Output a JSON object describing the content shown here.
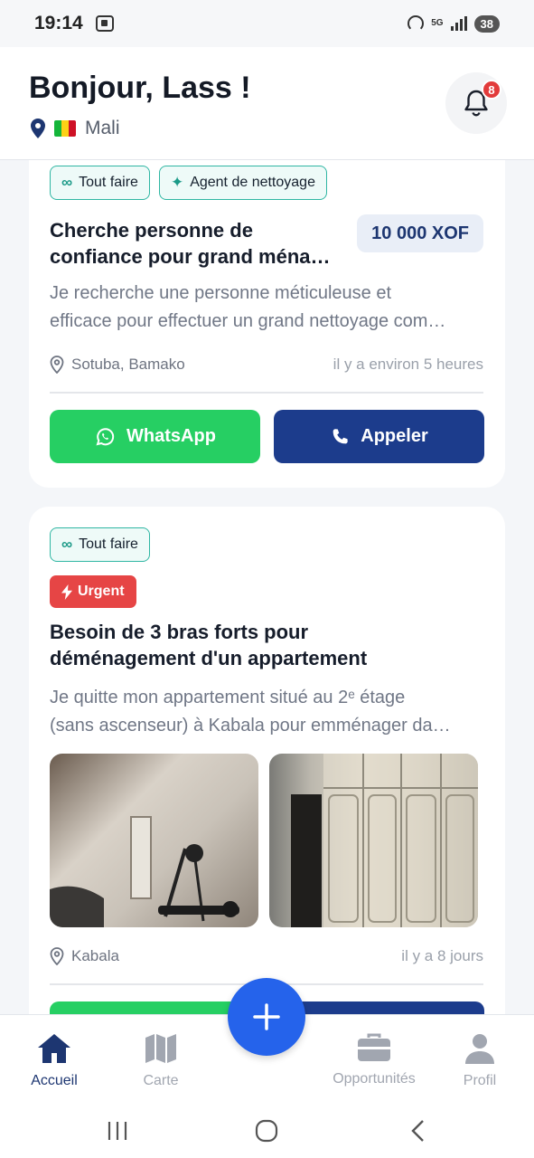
{
  "status_bar": {
    "time": "19:14",
    "network": "5G",
    "battery": "38"
  },
  "header": {
    "greeting": "Bonjour, Lass !",
    "country": "Mali",
    "notification_count": "8"
  },
  "posts": [
    {
      "tags": [
        {
          "label": "Tout faire",
          "icon": "infinity-icon"
        },
        {
          "label": "Agent de nettoyage",
          "icon": "sparkles-icon"
        }
      ],
      "title_line1": "Cherche personne de",
      "title_line2": "confiance pour grand ména…",
      "price": "10 000 XOF",
      "desc_line1": "Je recherche une personne méticuleuse et",
      "desc_line2": "efficace pour effectuer un grand nettoyage com…",
      "location": "Sotuba, Bamako",
      "posted": "il y a environ 5 heures",
      "whatsapp_label": "WhatsApp",
      "call_label": "Appeler"
    },
    {
      "tags": [
        {
          "label": "Tout faire",
          "icon": "infinity-icon"
        }
      ],
      "urgent_label": "Urgent",
      "title_line1": "Besoin de 3 bras forts pour",
      "title_line2": "déménagement d'un appartement",
      "desc_line1": "Je quitte mon appartement situé au 2ᵉ étage",
      "desc_line2": "(sans ascenseur) à Kabala pour emménager da…",
      "location": "Kabala",
      "posted": "il y a 8 jours"
    }
  ],
  "bottom_nav": {
    "items": [
      {
        "label": "Accueil",
        "icon": "home-icon",
        "active": true
      },
      {
        "label": "Carte",
        "icon": "map-icon",
        "active": false
      },
      {
        "label": "Opportunités",
        "icon": "briefcase-icon",
        "active": false
      },
      {
        "label": "Profil",
        "icon": "user-icon",
        "active": false
      }
    ],
    "fab_icon": "plus-icon"
  },
  "colors": {
    "primary": "#1c3c8c",
    "whatsapp": "#26cf63",
    "urgent": "#e64545",
    "fab": "#2563eb",
    "chip_border": "#2fb6a3"
  }
}
